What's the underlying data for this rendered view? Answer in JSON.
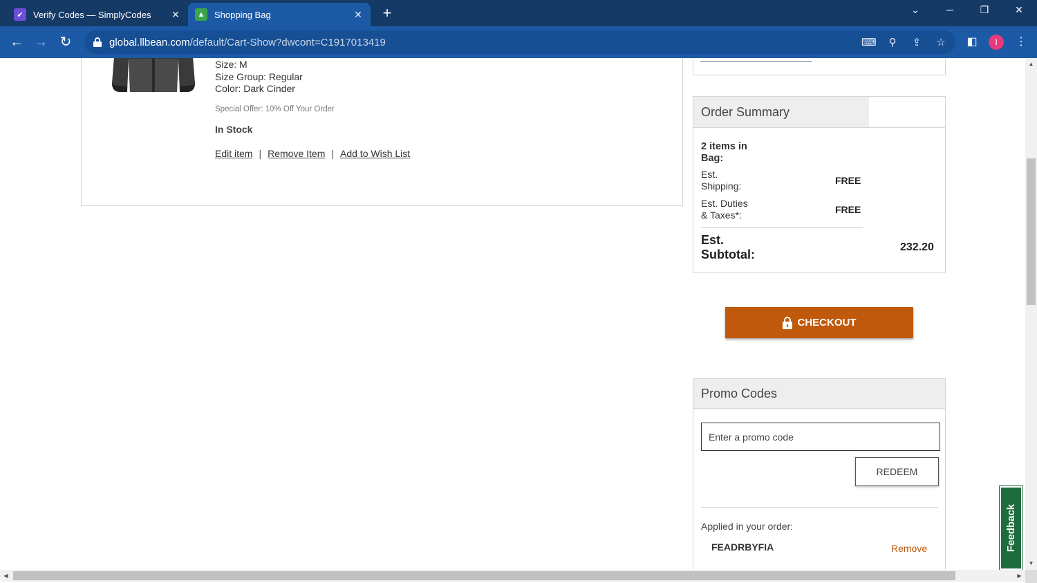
{
  "browser": {
    "tabs": [
      {
        "title": "Verify Codes — SimplyCodes",
        "active": false,
        "favicon": "simplycodes-favicon"
      },
      {
        "title": "Shopping Bag",
        "active": true,
        "favicon": "llbean-favicon"
      }
    ],
    "url_domain": "global.llbean.com",
    "url_path": "/default/Cart-Show?dwcont=C1917013419",
    "profile_initial": "I"
  },
  "item": {
    "size": "Size: M",
    "size_group": "Size Group: Regular",
    "color": "Color: Dark Cinder",
    "special_offer": "Special Offer: 10% Off Your Order",
    "stock": "In Stock",
    "links": {
      "edit": "Edit item",
      "remove": "Remove Item",
      "wishlist": "Add to Wish List",
      "separator": "|"
    }
  },
  "summary": {
    "title": "Order Summary",
    "items_label": "2 items in Bag:",
    "shipping_label": "Est. Shipping:",
    "shipping_value": "FREE",
    "duties_label": "Est. Duties & Taxes*:",
    "duties_value": "FREE",
    "subtotal_label": "Est. Subtotal:",
    "subtotal_value": "232.20"
  },
  "checkout": {
    "label": "CHECKOUT"
  },
  "promo": {
    "title": "Promo Codes",
    "input_placeholder": "Enter a promo code",
    "redeem_label": "REDEEM",
    "applied_label": "Applied in your order:",
    "code": "FEADRBYFIA",
    "remove_label": "Remove"
  },
  "feedback": {
    "label": "Feedback"
  },
  "colors": {
    "accent": "#c0590b",
    "chrome_dark": "#163a66",
    "chrome_light": "#1c5aa6",
    "feedback_green": "#1e6b3e"
  }
}
